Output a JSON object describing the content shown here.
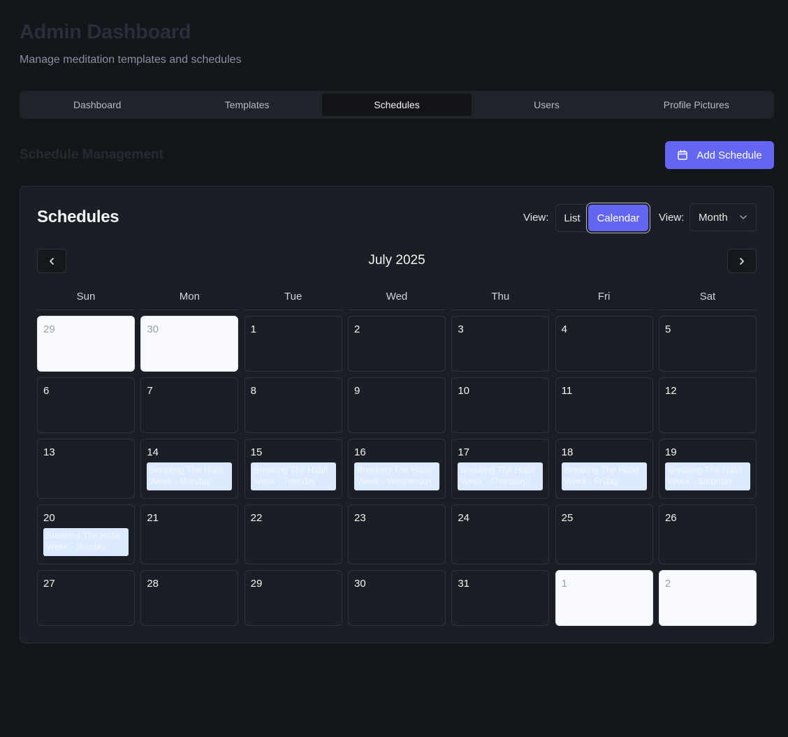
{
  "header": {
    "title": "Admin Dashboard",
    "subtitle": "Manage meditation templates and schedules"
  },
  "tabs": [
    {
      "label": "Dashboard",
      "active": false
    },
    {
      "label": "Templates",
      "active": false
    },
    {
      "label": "Schedules",
      "active": true
    },
    {
      "label": "Users",
      "active": false
    },
    {
      "label": "Profile Pictures",
      "active": false
    }
  ],
  "section": {
    "title": "Schedule Management",
    "add_button_label": "Add Schedule",
    "add_button_icon": "calendar-icon"
  },
  "card": {
    "title": "Schedules",
    "view_label_1": "View:",
    "toggle_list": "List",
    "toggle_calendar": "Calendar",
    "view_label_2": "View:",
    "view_select_value": "Month",
    "prev_icon": "chevron-left-icon",
    "next_icon": "chevron-right-icon",
    "month_label": "July 2025"
  },
  "calendar": {
    "weekdays": [
      "Sun",
      "Mon",
      "Tue",
      "Wed",
      "Thu",
      "Fri",
      "Sat"
    ],
    "cells": [
      {
        "day": "29",
        "outside": true
      },
      {
        "day": "30",
        "outside": true
      },
      {
        "day": "1"
      },
      {
        "day": "2"
      },
      {
        "day": "3"
      },
      {
        "day": "4"
      },
      {
        "day": "5"
      },
      {
        "day": "6"
      },
      {
        "day": "7"
      },
      {
        "day": "8"
      },
      {
        "day": "9"
      },
      {
        "day": "10"
      },
      {
        "day": "11"
      },
      {
        "day": "12"
      },
      {
        "day": "13"
      },
      {
        "day": "14",
        "event": "Breaking The Habit Week - Monday"
      },
      {
        "day": "15",
        "event": "Breaking The Habit Week - Tuesday"
      },
      {
        "day": "16",
        "event": "Breaking The Habit Week - Wednesday"
      },
      {
        "day": "17",
        "event": "Breaking The Habit Week - Thursday"
      },
      {
        "day": "18",
        "event": "Breaking The Habit Week - Friday"
      },
      {
        "day": "19",
        "event": "Breaking The Habit Week - Saturday"
      },
      {
        "day": "20",
        "event": "Breaking The Habit Week - Sunday"
      },
      {
        "day": "21"
      },
      {
        "day": "22"
      },
      {
        "day": "23"
      },
      {
        "day": "24"
      },
      {
        "day": "25"
      },
      {
        "day": "26"
      },
      {
        "day": "27"
      },
      {
        "day": "28"
      },
      {
        "day": "29"
      },
      {
        "day": "30"
      },
      {
        "day": "31"
      },
      {
        "day": "1",
        "outside": true
      },
      {
        "day": "2",
        "outside": true
      }
    ]
  }
}
